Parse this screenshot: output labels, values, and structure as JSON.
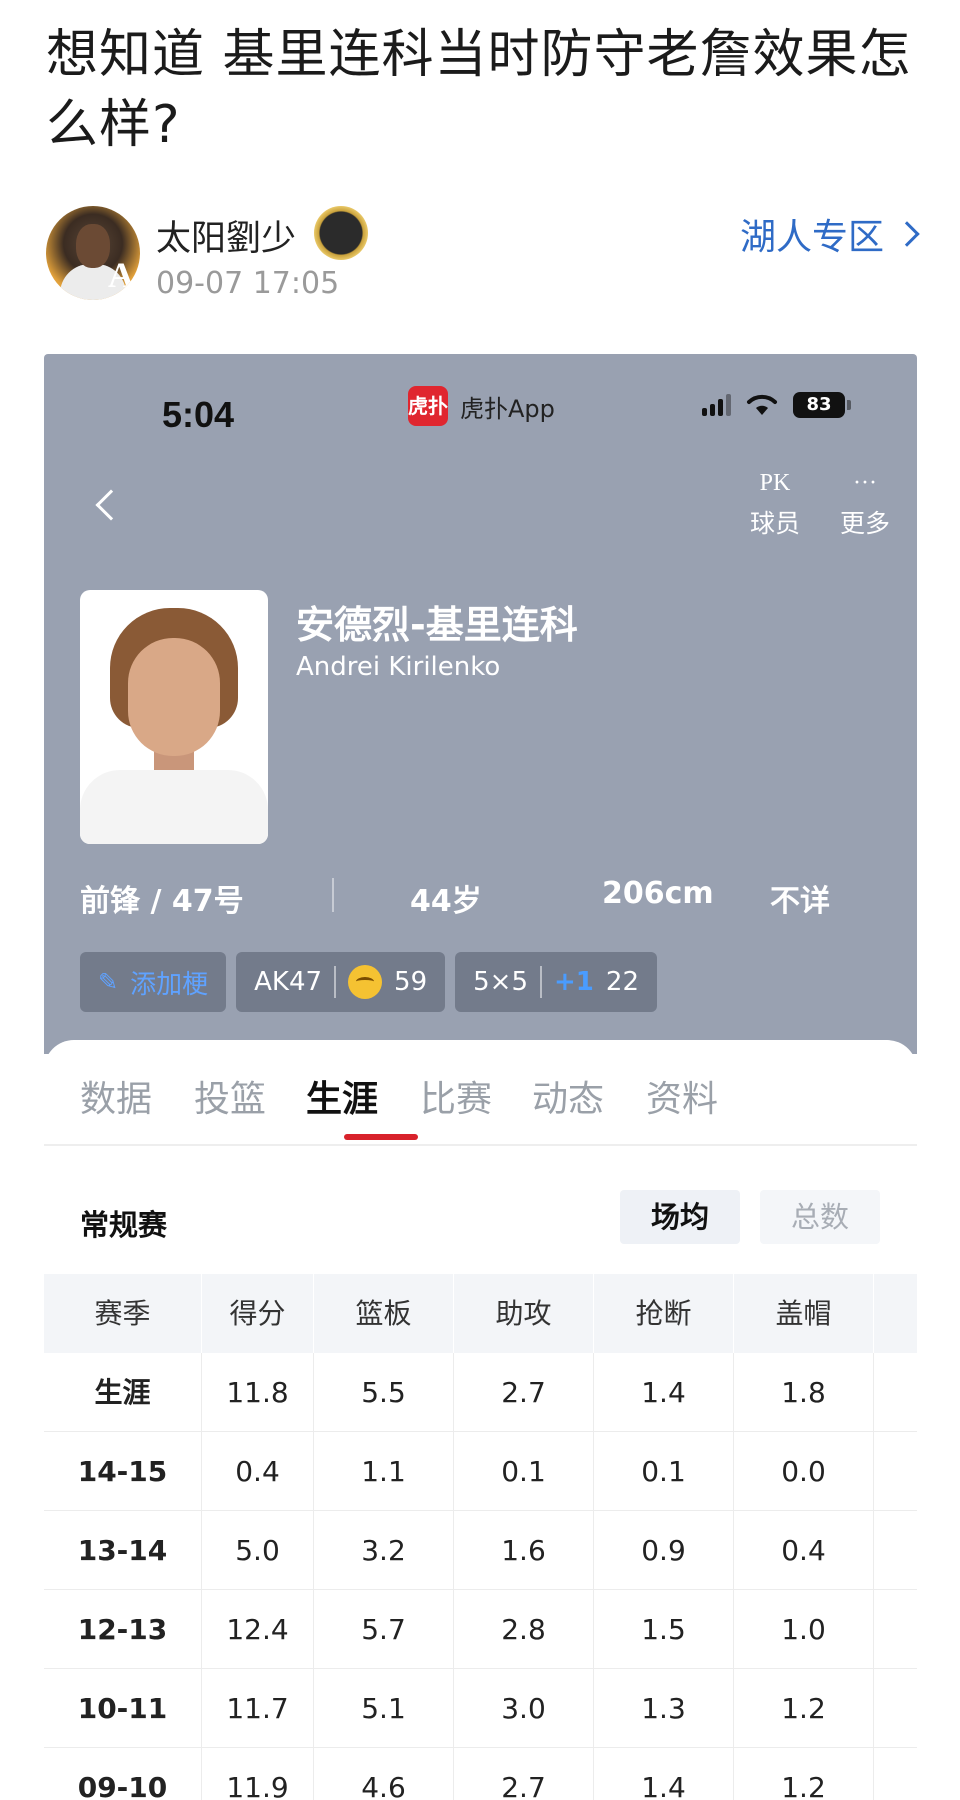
{
  "post": {
    "title": "想知道 基里连科当时防守老詹效果怎么样?",
    "author": "太阳劉少",
    "avatar_letter": "A",
    "time": "09-07 17:05",
    "zone": "湖人专区"
  },
  "app": {
    "status_time": "5:04",
    "app_logo": "虎扑",
    "app_name": "虎扑App",
    "battery": "83",
    "nav": {
      "pk_icon": "PK",
      "pk_label": "球员",
      "more_icon": "···",
      "more_label": "更多"
    },
    "player": {
      "name_cn": "安德烈-基里连科",
      "name_en": "Andrei Kirilenko",
      "position_number": "前锋 / 47号",
      "age": "44岁",
      "height": "206cm",
      "other": "不详"
    },
    "tags": {
      "add": "添加梗",
      "tag1_name": "AK47",
      "tag1_count": "59",
      "tag2_name": "5×5",
      "tag2_plus": "+1",
      "tag2_count": "22"
    },
    "tabs": [
      "数据",
      "投篮",
      "生涯",
      "比赛",
      "动态",
      "资料"
    ],
    "active_tab": "生涯",
    "section_title": "常规赛",
    "toggle_on": "场均",
    "toggle_off": "总数",
    "table": {
      "headers": [
        "赛季",
        "得分",
        "篮板",
        "助攻",
        "抢断",
        "盖帽"
      ],
      "rows": [
        [
          "生涯",
          "11.8",
          "5.5",
          "2.7",
          "1.4",
          "1.8"
        ],
        [
          "14-15",
          "0.4",
          "1.1",
          "0.1",
          "0.1",
          "0.0"
        ],
        [
          "13-14",
          "5.0",
          "3.2",
          "1.6",
          "0.9",
          "0.4"
        ],
        [
          "12-13",
          "12.4",
          "5.7",
          "2.8",
          "1.5",
          "1.0"
        ],
        [
          "10-11",
          "11.7",
          "5.1",
          "3.0",
          "1.3",
          "1.2"
        ],
        [
          "09-10",
          "11.9",
          "4.6",
          "2.7",
          "1.4",
          "1.2"
        ]
      ]
    }
  },
  "colors": {
    "accent": "#2f6bc6",
    "header_bg": "#99a1b1",
    "tab_indicator": "#d8222b",
    "hupu_red": "#e0262f"
  }
}
